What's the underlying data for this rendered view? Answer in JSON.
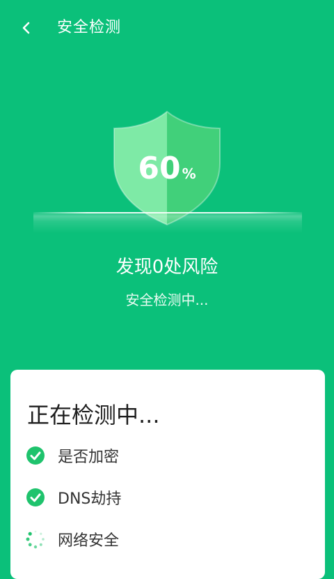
{
  "header": {
    "title": "安全检测",
    "back_icon": "chevron-left-icon"
  },
  "scan": {
    "progress_number": "60",
    "progress_unit": "%",
    "progress_value": 60,
    "risk_summary": "发现0处风险",
    "status": "安全检测中..."
  },
  "card": {
    "title": "正在检测中...",
    "items": [
      {
        "label": "是否加密",
        "state": "done",
        "icon": "check-circle-icon"
      },
      {
        "label": "DNS劫持",
        "state": "done",
        "icon": "check-circle-icon"
      },
      {
        "label": "网络安全",
        "state": "loading",
        "icon": "spinner-icon"
      }
    ]
  },
  "colors": {
    "background": "#0BC07A",
    "shield_left": "#7EEAA6",
    "shield_right": "#41D07A",
    "check": "#1FC36D"
  }
}
